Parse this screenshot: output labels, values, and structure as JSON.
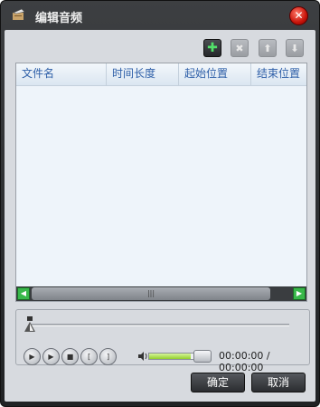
{
  "window": {
    "title": "编辑音频"
  },
  "toolbar": {
    "add": {
      "icon": "plus-icon",
      "glyph": "✚"
    },
    "remove": {
      "icon": "x-icon",
      "glyph": "✖"
    },
    "up": {
      "icon": "arrow-up-icon",
      "glyph": "⬆"
    },
    "down": {
      "icon": "arrow-down-icon",
      "glyph": "⬇"
    }
  },
  "list": {
    "columns": [
      "文件名",
      "时间长度",
      "起始位置",
      "结束位置"
    ],
    "rows": []
  },
  "player": {
    "time_display": "00:00:00 / 00:00:00",
    "volume_level": 0.7,
    "seek_position": 0
  },
  "buttons": {
    "ok": "确定",
    "cancel": "取消"
  },
  "colors": {
    "accent_green": "#38b84a",
    "close_red": "#c8140a",
    "header_text": "#2e5fa8"
  }
}
